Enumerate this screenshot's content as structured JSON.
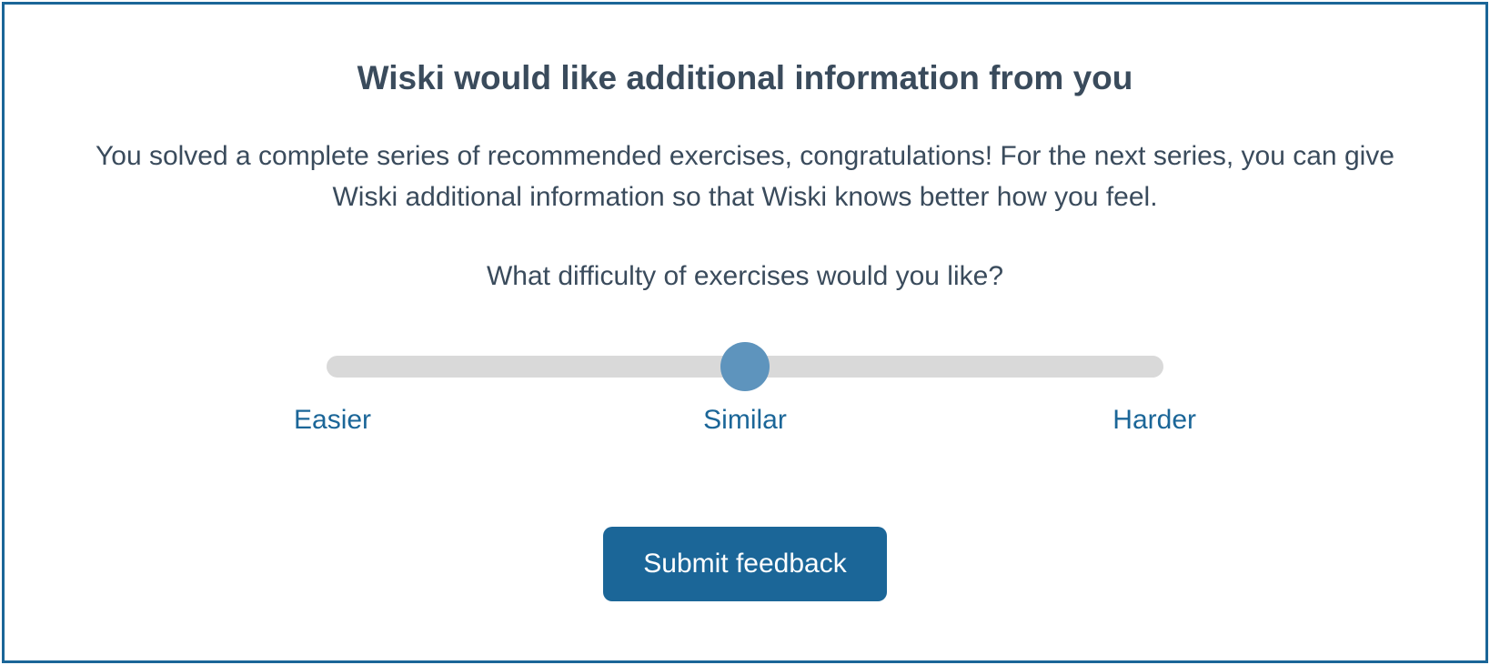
{
  "dialog": {
    "title": "Wiski would like additional information from you",
    "description": "You solved a complete series of recommended exercises, congratulations! For the next series, you can give Wiski additional information so that Wiski knows better how you feel.",
    "question": "What difficulty of exercises would you like?"
  },
  "slider": {
    "min_label": "Easier",
    "mid_label": "Similar",
    "max_label": "Harder",
    "value_percent": 50
  },
  "buttons": {
    "submit": "Submit feedback"
  },
  "colors": {
    "primary": "#1b6698",
    "text": "#3a4b5c",
    "thumb": "#5e94bd",
    "track": "#d9d9d9"
  }
}
